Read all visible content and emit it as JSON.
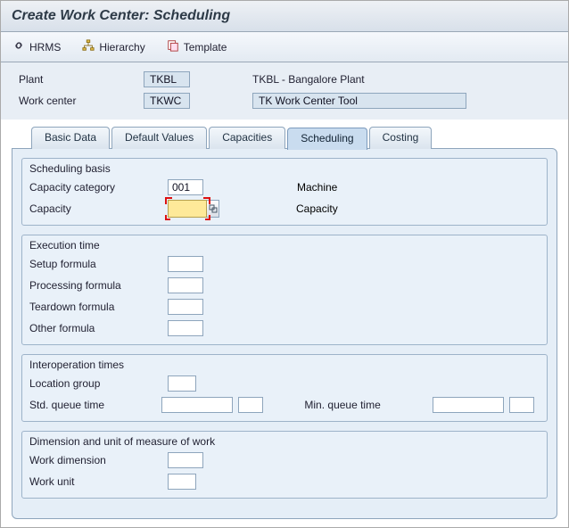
{
  "title": "Create Work Center: Scheduling",
  "toolbar": {
    "hrms": "HRMS",
    "hierarchy": "Hierarchy",
    "template": "Template"
  },
  "header": {
    "plant_label": "Plant",
    "plant_value": "TKBL",
    "plant_desc": "TKBL - Bangalore Plant",
    "wc_label": "Work center",
    "wc_value": "TKWC",
    "wc_desc": "TK Work Center Tool"
  },
  "tabs": {
    "basic": "Basic Data",
    "defaults": "Default Values",
    "capacities": "Capacities",
    "scheduling": "Scheduling",
    "costing": "Costing"
  },
  "groups": {
    "g1": {
      "title": "Scheduling basis",
      "capcat_lbl": "Capacity category",
      "capcat_val": "001",
      "capcat_txt": "Machine",
      "cap_lbl": "Capacity",
      "cap_val": "",
      "cap_txt": "Capacity"
    },
    "g2": {
      "title": "Execution time",
      "setup_lbl": "Setup formula",
      "setup_val": "",
      "proc_lbl": "Processing formula",
      "proc_val": "",
      "tear_lbl": "Teardown formula",
      "tear_val": "",
      "other_lbl": "Other formula",
      "other_val": ""
    },
    "g3": {
      "title": "Interoperation times",
      "loc_lbl": "Location group",
      "loc_val": "",
      "stdq_lbl": "Std. queue time",
      "stdq_val": "",
      "stdq_unit": "",
      "minq_lbl": "Min. queue time",
      "minq_val": "",
      "minq_unit": ""
    },
    "g4": {
      "title": "Dimension and unit of measure of work",
      "dim_lbl": "Work dimension",
      "dim_val": "",
      "unit_lbl": "Work unit",
      "unit_val": ""
    }
  }
}
